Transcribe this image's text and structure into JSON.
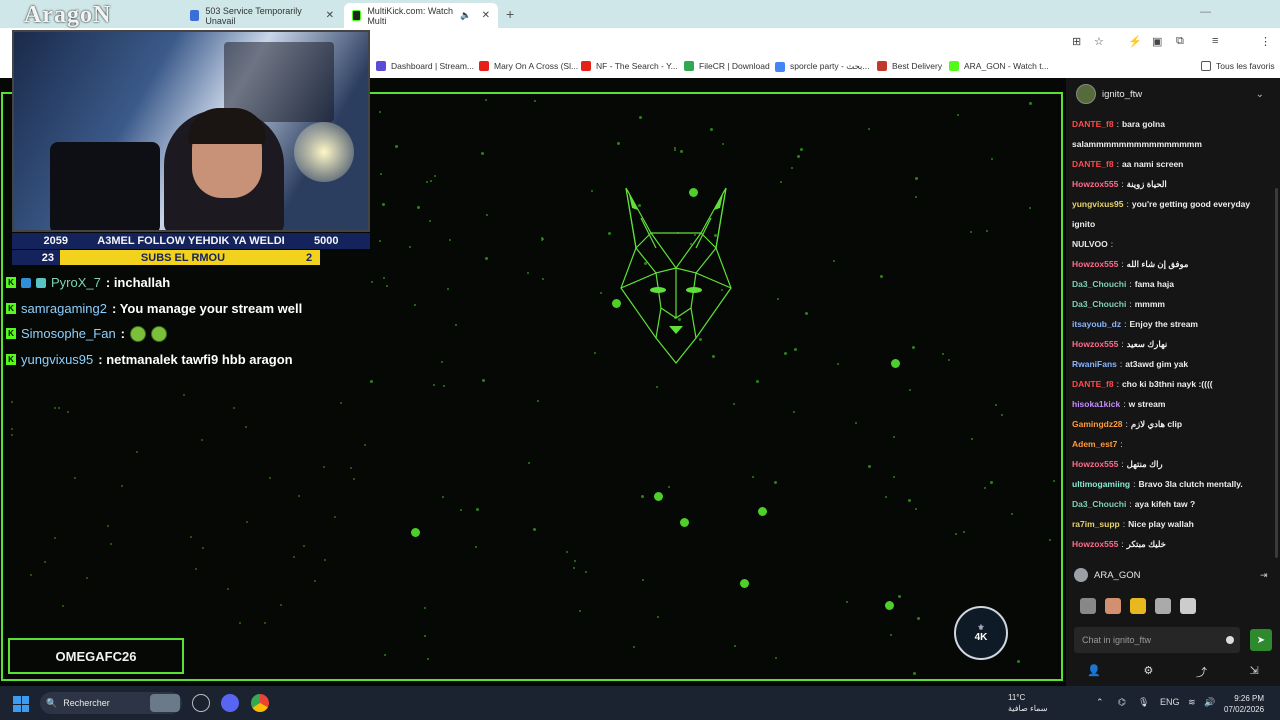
{
  "browser": {
    "tabs": [
      {
        "title": "503 Service Temporarily Unavail"
      },
      {
        "title": "MultiKick.com: Watch Multi"
      }
    ],
    "new_tab": "+",
    "bookmarks": [
      {
        "label": "Dashboard | Stream..."
      },
      {
        "label": "Mary On A Cross (Sl..."
      },
      {
        "label": "NF - The Search - Y..."
      },
      {
        "label": "FileCR | Download"
      },
      {
        "label": "sporcle party - بحث..."
      },
      {
        "label": "Best Delivery"
      },
      {
        "label": "ARA_GON - Watch t..."
      },
      {
        "label": "Tous les favoris"
      }
    ]
  },
  "stream_overlay": {
    "logo_text": "AragoN",
    "goal_bar": {
      "left": "2059",
      "text": "A3MEL FOLLOW YEHDIK YA WELDI",
      "right": "5000"
    },
    "subs_bar": {
      "left": "23",
      "text": "SUBS EL RMOU",
      "right": "2"
    },
    "overlay_chat": [
      {
        "user": "PyroX_7",
        "text": " : inchallah"
      },
      {
        "user": "samragaming2",
        "text": " : You manage your stream well"
      },
      {
        "user": "Simosophe_Fan",
        "text": " : "
      },
      {
        "user": "yungvixus95",
        "text": " : netmanalek tawfi9 hbb aragon"
      }
    ],
    "streamer_name": "OMEGAFC26",
    "corner_logo": "4K"
  },
  "chat_panel": {
    "channel": "ignito_ftw",
    "messages": [
      {
        "user": "DANTE_f8",
        "color": "#ff4b4b",
        "text": "bara golna"
      },
      {
        "user": "",
        "color": "#eeeeee",
        "text": "salammmmmmmmmmmmmmm"
      },
      {
        "user": "DANTE_f8",
        "color": "#ff4b4b",
        "text": "aa nami screen"
      },
      {
        "user": "Howzox555",
        "color": "#ff6b8a",
        "text": "الحياة زوينة"
      },
      {
        "user": "yungvixus95",
        "color": "#e8d46a",
        "text": "you're getting good everyday"
      },
      {
        "user": "",
        "color": "#eeeeee",
        "text": "ignito"
      },
      {
        "user": "NULVOO",
        "color": "#e8e8e8",
        "text": ""
      },
      {
        "user": "Howzox555",
        "color": "#ff6b8a",
        "text": "موفق إن شاء الله"
      },
      {
        "user": "Da3_Chouchi",
        "color": "#7fd0b8",
        "text": "fama haja"
      },
      {
        "user": "Da3_Chouchi",
        "color": "#7fd0b8",
        "text": "mmmm"
      },
      {
        "user": "itsayoub_dz",
        "color": "#8ab4ff",
        "text": "Enjoy the stream"
      },
      {
        "user": "Howzox555",
        "color": "#ff6b8a",
        "text": "نهارك سعيد"
      },
      {
        "user": "RwaniFans",
        "color": "#8ab4ff",
        "text": "at3awd gim yak"
      },
      {
        "user": "DANTE_f8",
        "color": "#ff4b4b",
        "text": "cho ki b3thni nayk :(((("
      },
      {
        "user": "hisoka1kick",
        "color": "#c88cff",
        "text": "w stream"
      },
      {
        "user": "Gamingdz28",
        "color": "#ff9b3b",
        "text": "هادي لازم clip"
      },
      {
        "user": "Adem_est7",
        "color": "#ff9b3b",
        "text": ""
      },
      {
        "user": "Howzox555",
        "color": "#ff6b8a",
        "text": "راك منتهل"
      },
      {
        "user": "ultimogamiing",
        "color": "#8ae8d0",
        "text": "Bravo 3la clutch mentally."
      },
      {
        "user": "Da3_Chouchi",
        "color": "#7fd0b8",
        "text": "aya kifeh taw ?"
      },
      {
        "user": "ra7im_supp",
        "color": "#e8d46a",
        "text": "Nice play wallah"
      },
      {
        "user": "Howzox555",
        "color": "#ff6b8a",
        "text": "خليك مبتكر"
      }
    ],
    "current_user": "ARA_GON",
    "input_placeholder": "Chat in ignito_ftw"
  },
  "taskbar": {
    "search_label": "Rechercher",
    "weather_temp": "11°C",
    "weather_desc": "سماء صافية",
    "lang": "ENG",
    "time": "9:26 PM",
    "date": "07/02/2026"
  }
}
